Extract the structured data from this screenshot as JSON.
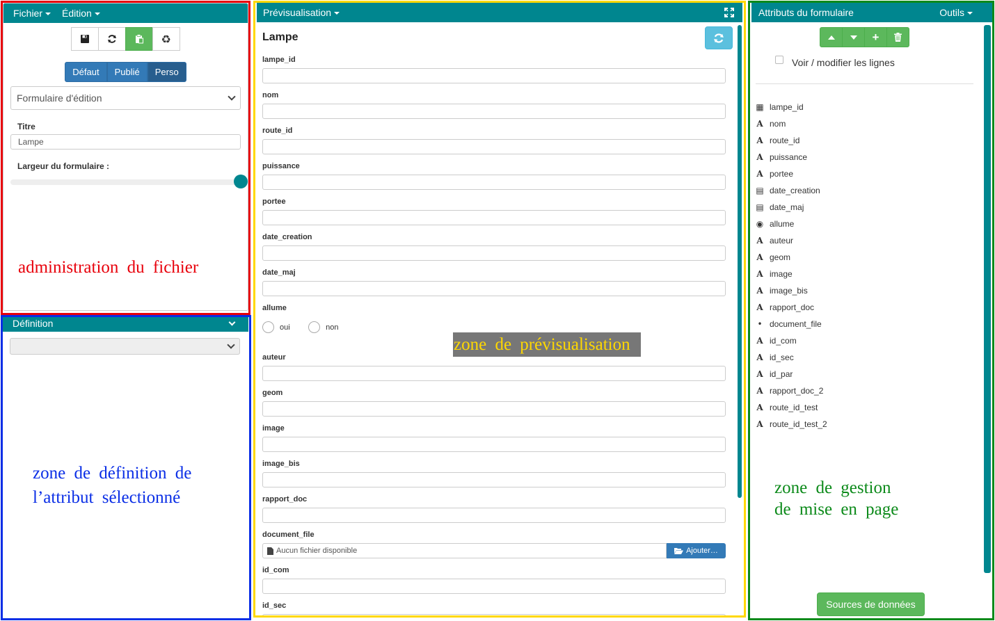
{
  "admin": {
    "menu_file": "Fichier",
    "menu_edit": "Édition",
    "toolbar": {
      "save_icon": "floppy-icon",
      "reload_icon": "refresh-icon",
      "paste_icon": "clipboard-icon",
      "recycle_icon": "recycle-icon"
    },
    "modes": [
      "Défaut",
      "Publié",
      "Perso"
    ],
    "form_select": "Formulaire d'édition",
    "title_label": "Titre",
    "title_value": "Lampe",
    "width_label": "Largeur du formulaire :",
    "width_value": 1.0,
    "overlay": "administration du fichier"
  },
  "definition": {
    "title": "Définition",
    "select_value": "",
    "overlay_line1": "zone de définition de",
    "overlay_line2": "l’attribut sélectionné"
  },
  "preview": {
    "title": "Prévisualisation",
    "form_title": "Lampe",
    "fields": {
      "lampe_id": "lampe_id",
      "nom": "nom",
      "route_id": "route_id",
      "puissance": "puissance",
      "portee": "portee",
      "date_creation": "date_creation",
      "date_maj": "date_maj",
      "allume": "allume",
      "auteur": "auteur",
      "geom": "geom",
      "image": "image",
      "image_bis": "image_bis",
      "rapport_doc": "rapport_doc",
      "document_file": "document_file",
      "id_com": "id_com",
      "id_sec": "id_sec"
    },
    "radio_yes": "oui",
    "radio_no": "non",
    "file_placeholder": "Aucun fichier disponible",
    "file_button": "Ajouter…",
    "overlay": "zone de prévisualisation"
  },
  "attributes": {
    "title": "Attributs du formulaire",
    "tools": "Outils",
    "checkbox_label": "Voir / modifier les lignes",
    "items": [
      {
        "name": "lampe_id",
        "icon": "calculator-icon"
      },
      {
        "name": "nom",
        "icon": "text-icon"
      },
      {
        "name": "route_id",
        "icon": "text-icon"
      },
      {
        "name": "puissance",
        "icon": "text-icon"
      },
      {
        "name": "portee",
        "icon": "text-icon"
      },
      {
        "name": "date_creation",
        "icon": "calendar-icon"
      },
      {
        "name": "date_maj",
        "icon": "calendar-icon"
      },
      {
        "name": "allume",
        "icon": "radio-icon"
      },
      {
        "name": "auteur",
        "icon": "text-icon"
      },
      {
        "name": "geom",
        "icon": "text-icon"
      },
      {
        "name": "image",
        "icon": "text-icon"
      },
      {
        "name": "image_bis",
        "icon": "text-icon"
      },
      {
        "name": "rapport_doc",
        "icon": "text-icon"
      },
      {
        "name": "document_file",
        "icon": "bullet-icon"
      },
      {
        "name": "id_com",
        "icon": "text-icon"
      },
      {
        "name": "id_sec",
        "icon": "text-icon"
      },
      {
        "name": "id_par",
        "icon": "text-icon"
      },
      {
        "name": "rapport_doc_2",
        "icon": "text-icon"
      },
      {
        "name": "route_id_test",
        "icon": "text-icon"
      },
      {
        "name": "route_id_test_2",
        "icon": "text-icon"
      }
    ],
    "sources_button": "Sources de données",
    "overlay_line1": "zone de gestion",
    "overlay_line2": "de mise en page"
  },
  "colors": {
    "accent": "#00868f",
    "red": "#e8000b",
    "blue": "#0a2ee6",
    "yellow": "#ffd800",
    "green": "#0c8a1a",
    "preview_label_bg": "#777777"
  }
}
